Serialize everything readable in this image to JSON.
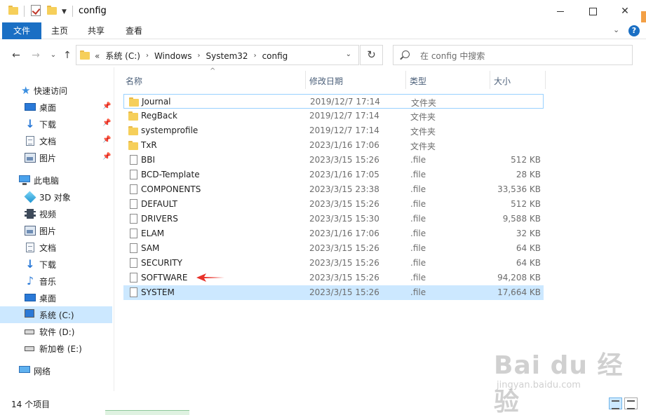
{
  "window": {
    "title": "config"
  },
  "ribbon": {
    "tabs": [
      {
        "label": "文件"
      },
      {
        "label": "主页"
      },
      {
        "label": "共享"
      },
      {
        "label": "查看"
      }
    ],
    "help_label": "?"
  },
  "address": {
    "lead": "«",
    "crumbs": [
      "系统 (C:)",
      "Windows",
      "System32",
      "config"
    ]
  },
  "search": {
    "placeholder": "在 config 中搜索"
  },
  "sidebar": {
    "items": [
      {
        "label": "快速访问",
        "icon": "star-icon",
        "pinned": false
      },
      {
        "label": "桌面",
        "icon": "desktop-icon",
        "pinned": true
      },
      {
        "label": "下载",
        "icon": "download-icon",
        "pinned": true
      },
      {
        "label": "文档",
        "icon": "document-icon",
        "pinned": true
      },
      {
        "label": "图片",
        "icon": "picture-icon",
        "pinned": true
      },
      {
        "label": "此电脑",
        "icon": "computer-icon",
        "pinned": false
      },
      {
        "label": "3D 对象",
        "icon": "3d-objects-icon",
        "pinned": false
      },
      {
        "label": "视频",
        "icon": "video-icon",
        "pinned": false
      },
      {
        "label": "图片",
        "icon": "picture-icon",
        "pinned": false
      },
      {
        "label": "文档",
        "icon": "document-icon",
        "pinned": false
      },
      {
        "label": "下载",
        "icon": "download-icon",
        "pinned": false
      },
      {
        "label": "音乐",
        "icon": "music-icon",
        "pinned": false
      },
      {
        "label": "桌面",
        "icon": "desktop-icon",
        "pinned": false
      },
      {
        "label": "系统 (C:)",
        "icon": "drive-c-icon",
        "pinned": false,
        "selected": true
      },
      {
        "label": "软件 (D:)",
        "icon": "drive-icon",
        "pinned": false
      },
      {
        "label": "新加卷 (E:)",
        "icon": "drive-icon",
        "pinned": false
      },
      {
        "label": "网络",
        "icon": "network-icon",
        "pinned": false
      }
    ]
  },
  "columns": [
    {
      "label": "名称"
    },
    {
      "label": "修改日期"
    },
    {
      "label": "类型"
    },
    {
      "label": "大小"
    }
  ],
  "files": [
    {
      "name": "Journal",
      "date": "2019/12/7 17:14",
      "type": "文件夹",
      "size": "",
      "kind": "folder"
    },
    {
      "name": "RegBack",
      "date": "2019/12/7 17:14",
      "type": "文件夹",
      "size": "",
      "kind": "folder"
    },
    {
      "name": "systemprofile",
      "date": "2019/12/7 17:14",
      "type": "文件夹",
      "size": "",
      "kind": "folder"
    },
    {
      "name": "TxR",
      "date": "2023/1/16 17:06",
      "type": "文件夹",
      "size": "",
      "kind": "folder"
    },
    {
      "name": "BBI",
      "date": "2023/3/15 15:26",
      "type": ".file",
      "size": "512 KB",
      "kind": "file"
    },
    {
      "name": "BCD-Template",
      "date": "2023/1/16 17:05",
      "type": ".file",
      "size": "28 KB",
      "kind": "file"
    },
    {
      "name": "COMPONENTS",
      "date": "2023/3/15 23:38",
      "type": ".file",
      "size": "33,536 KB",
      "kind": "file"
    },
    {
      "name": "DEFAULT",
      "date": "2023/3/15 15:26",
      "type": ".file",
      "size": "512 KB",
      "kind": "file"
    },
    {
      "name": "DRIVERS",
      "date": "2023/3/15 15:30",
      "type": ".file",
      "size": "9,588 KB",
      "kind": "file"
    },
    {
      "name": "ELAM",
      "date": "2023/1/16 17:06",
      "type": ".file",
      "size": "32 KB",
      "kind": "file"
    },
    {
      "name": "SAM",
      "date": "2023/3/15 15:26",
      "type": ".file",
      "size": "64 KB",
      "kind": "file"
    },
    {
      "name": "SECURITY",
      "date": "2023/3/15 15:26",
      "type": ".file",
      "size": "64 KB",
      "kind": "file"
    },
    {
      "name": "SOFTWARE",
      "date": "2023/3/15 15:26",
      "type": ".file",
      "size": "94,208 KB",
      "kind": "file"
    },
    {
      "name": "SYSTEM",
      "date": "2023/3/15 15:26",
      "type": ".file",
      "size": "17,664 KB",
      "kind": "file",
      "selected": true
    }
  ],
  "status": {
    "count": "14 个项目"
  },
  "colors": {
    "accent": "#1a6fc4",
    "selection": "#cce8ff",
    "annotation_arrow": "#e8322a"
  },
  "watermark": {
    "main": "Bai du 经验",
    "sub": "jingyan.baidu.com"
  }
}
